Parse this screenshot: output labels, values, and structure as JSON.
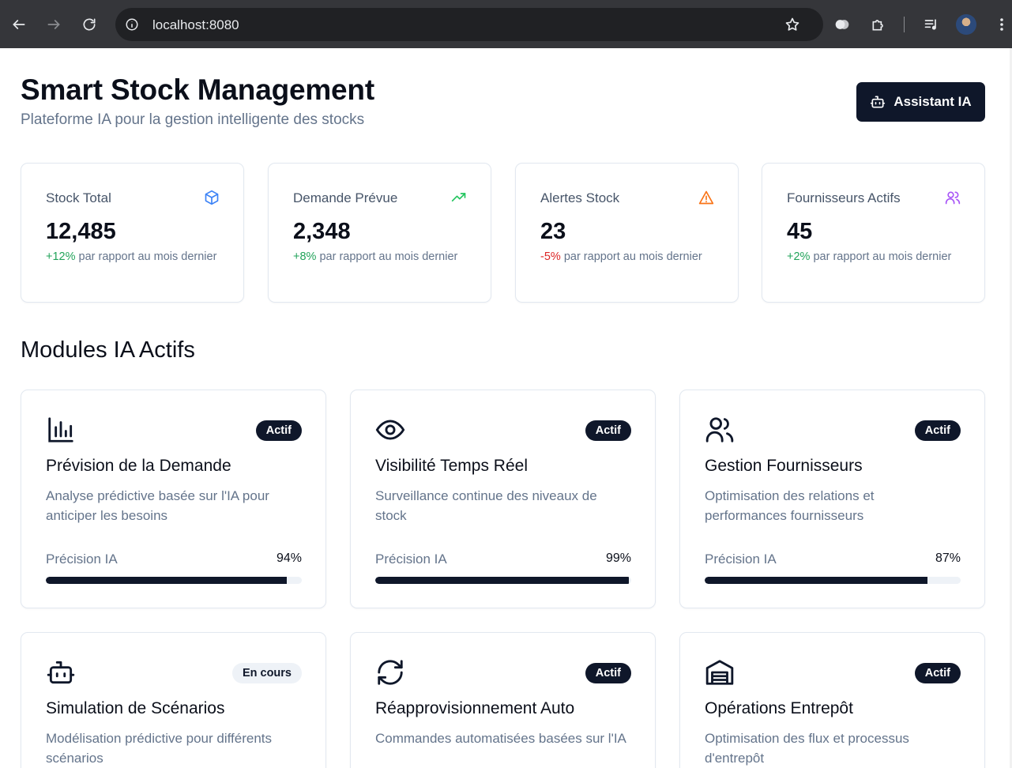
{
  "browser": {
    "url": "localhost:8080"
  },
  "header": {
    "title": "Smart Stock Management",
    "subtitle": "Plateforme IA pour la gestion intelligente des stocks",
    "assistant_label": "Assistant IA"
  },
  "stats": [
    {
      "label": "Stock Total",
      "value": "12,485",
      "trend": "+12%",
      "trend_text": " par rapport au mois dernier",
      "icon": "box-icon",
      "trend_color": "#22a35a"
    },
    {
      "label": "Demande Prévue",
      "value": "2,348",
      "trend": "+8%",
      "trend_text": " par rapport au mois dernier",
      "icon": "trending-up-icon",
      "trend_color": "#22a35a"
    },
    {
      "label": "Alertes Stock",
      "value": "23",
      "trend": "-5%",
      "trend_text": " par rapport au mois dernier",
      "icon": "alert-triangle-icon",
      "trend_color": "#dc2626"
    },
    {
      "label": "Fournisseurs Actifs",
      "value": "45",
      "trend": "+2%",
      "trend_text": " par rapport au mois dernier",
      "icon": "users-icon",
      "trend_color": "#22a35a"
    }
  ],
  "modules_title": "Modules IA Actifs",
  "modules": [
    {
      "title": "Prévision de la Demande",
      "description": "Analyse prédictive basée sur l'IA pour anticiper les besoins",
      "status": "Actif",
      "precision_label": "Précision IA",
      "precision": "94%",
      "precision_value": 0.94,
      "icon": "bar-chart-icon"
    },
    {
      "title": "Visibilité Temps Réel",
      "description": "Surveillance continue des niveaux de stock",
      "status": "Actif",
      "precision_label": "Précision IA",
      "precision": "99%",
      "precision_value": 0.99,
      "icon": "eye-icon"
    },
    {
      "title": "Gestion Fournisseurs",
      "description": "Optimisation des relations et performances fournisseurs",
      "status": "Actif",
      "precision_label": "Précision IA",
      "precision": "87%",
      "precision_value": 0.87,
      "icon": "users-icon"
    },
    {
      "title": "Simulation de Scénarios",
      "description": "Modélisation prédictive pour différents scénarios",
      "status": "En cours",
      "icon": "bot-icon"
    },
    {
      "title": "Réapprovisionnement Auto",
      "description": "Commandes automatisées basées sur l'IA",
      "status": "Actif",
      "icon": "refresh-icon"
    },
    {
      "title": "Opérations Entrepôt",
      "description": "Optimisation des flux et processus d'entrepôt",
      "status": "Actif",
      "icon": "warehouse-icon"
    }
  ],
  "colors": {
    "primary": "#0f172a",
    "positive": "#22a35a",
    "negative": "#dc2626",
    "box_icon": "#3b82f6",
    "trend_icon": "#22c55e",
    "alert_icon": "#f97316",
    "users_icon": "#a855f7"
  }
}
